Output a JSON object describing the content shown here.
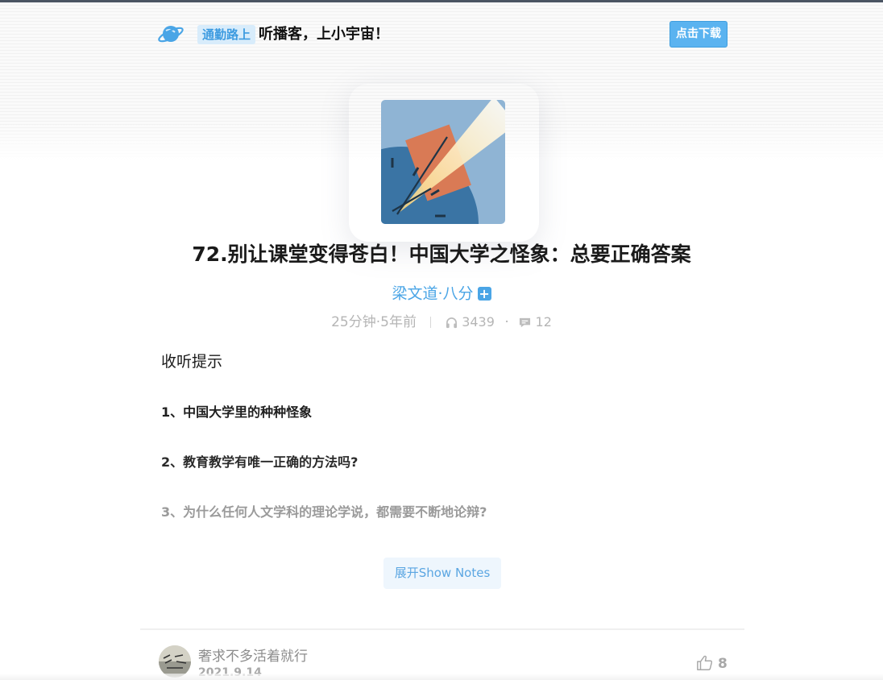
{
  "header": {
    "slogan_tag": "通勤路上",
    "slogan_text": "听播客，上小宇宙！",
    "download_label": "点击下载"
  },
  "episode": {
    "title": "72.别让课堂变得苍白！中国大学之怪象：总要正确答案",
    "podcast_name": "梁文道·八分",
    "subscribe_symbol": "+",
    "duration_age": "25分钟·5年前",
    "plays": "3439",
    "separator": "·",
    "comments": "12"
  },
  "show_notes": {
    "heading": "收听提示",
    "items": [
      "1、中国大学里的种种怪象",
      "2、教育教学有唯一正确的方法吗?",
      "3、为什么任何人文学科的理论学说，都需要不断地论辩?"
    ],
    "expand_label": "展开Show Notes"
  },
  "comment": {
    "author": "奢求不多活着就行",
    "date": "2021.9.14",
    "likes": "8"
  },
  "colors": {
    "accent": "#4aa5e6",
    "download_bg": "#5ab3f0",
    "tag_bg": "#d8ecfb",
    "cover_bg": "#8fb4d4",
    "cover_clock": "#3a74a4",
    "cover_orange": "#d97a55"
  },
  "icons": {
    "logo": "planet-icon",
    "subscribe": "plus-icon",
    "plays": "headphones-icon",
    "comments": "comment-icon",
    "like": "thumbs-up-icon"
  }
}
